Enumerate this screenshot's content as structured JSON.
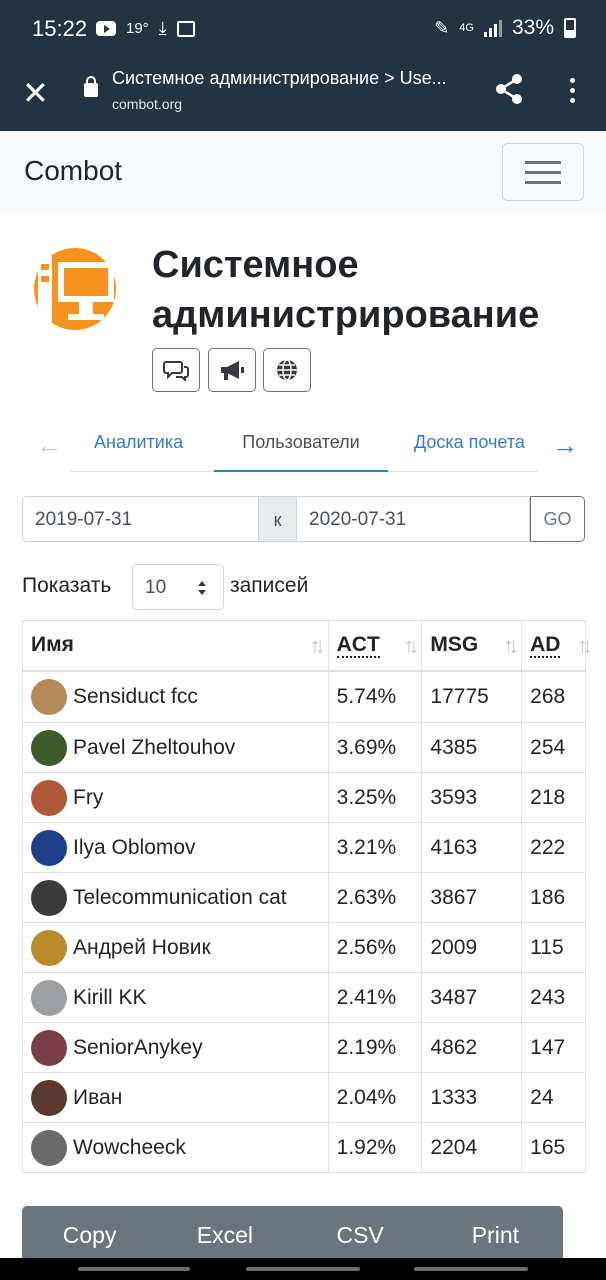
{
  "status_bar": {
    "time": "15:22",
    "temp": "19°",
    "network": "4G",
    "battery": "33%"
  },
  "browser": {
    "title": "Системное администрирование > Use...",
    "url": "combot.org"
  },
  "navbar": {
    "brand": "Combot"
  },
  "group": {
    "title_line1": "Системное",
    "title_line2": "администрирование",
    "logo_color": "#f7931e"
  },
  "tabs": [
    {
      "label": "Аналитика"
    },
    {
      "label": "Пользователи"
    },
    {
      "label": "Доска почета"
    }
  ],
  "date_range": {
    "from": "2019-07-31",
    "separator": "к",
    "to": "2020-07-31",
    "go_label": "GO"
  },
  "page_length": {
    "prefix": "Показать",
    "value": "10",
    "suffix": "записей"
  },
  "table": {
    "headers": [
      "Имя",
      "ACT",
      "MSG",
      "AD"
    ],
    "rows": [
      {
        "name": "Sensiduct fcc",
        "act": "5.74%",
        "msg": "17775",
        "ad": "268",
        "avatar": "#b58a5a"
      },
      {
        "name": "Pavel Zheltouhov",
        "act": "3.69%",
        "msg": "4385",
        "ad": "254",
        "avatar": "#3d5a2a"
      },
      {
        "name": "Fry",
        "act": "3.25%",
        "msg": "3593",
        "ad": "218",
        "avatar": "#b0583a"
      },
      {
        "name": "Ilya Oblomov",
        "act": "3.21%",
        "msg": "4163",
        "ad": "222",
        "avatar": "#1f3f8a"
      },
      {
        "name": "Telecommunication cat",
        "act": "2.63%",
        "msg": "3867",
        "ad": "186",
        "avatar": "#3a3a3a"
      },
      {
        "name": "Андрей Новик",
        "act": "2.56%",
        "msg": "2009",
        "ad": "115",
        "avatar": "#b88a2e"
      },
      {
        "name": "Kirill KK",
        "act": "2.41%",
        "msg": "3487",
        "ad": "243",
        "avatar": "#9aa0a4"
      },
      {
        "name": "SeniorAnykey",
        "act": "2.19%",
        "msg": "4862",
        "ad": "147",
        "avatar": "#7a3d4a"
      },
      {
        "name": "Иван",
        "act": "2.04%",
        "msg": "1333",
        "ad": "24",
        "avatar": "#5a3a30"
      },
      {
        "name": "Wowcheeck",
        "act": "1.92%",
        "msg": "2204",
        "ad": "165",
        "avatar": "#6a6a6a"
      }
    ]
  },
  "export_buttons": [
    "Copy",
    "Excel",
    "CSV",
    "Print"
  ],
  "colors": {
    "header_bg": "#233340",
    "link": "#007bff",
    "secondary": "#6c757d"
  }
}
